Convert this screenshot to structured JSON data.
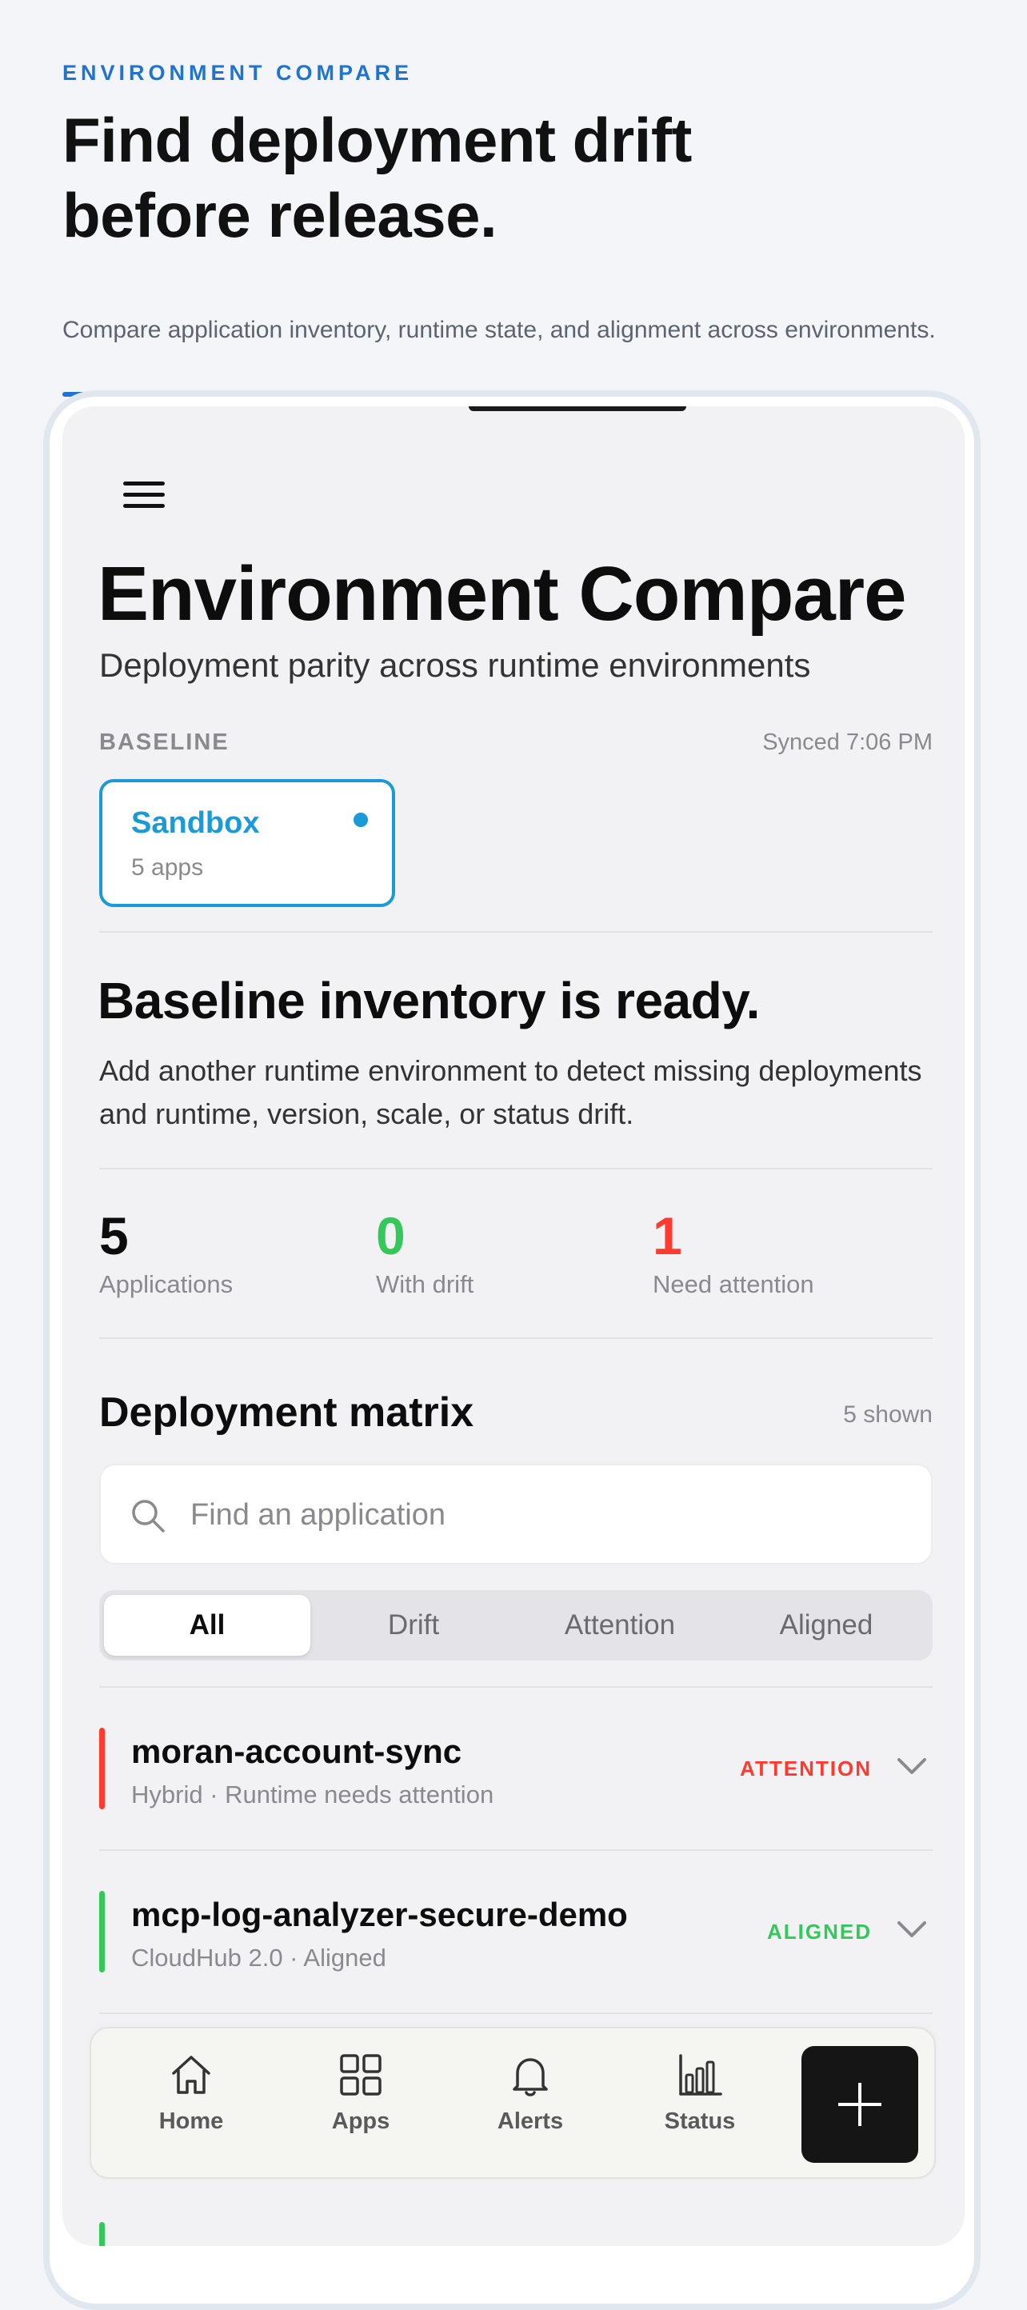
{
  "hero": {
    "eyebrow": "ENVIRONMENT COMPARE",
    "title": "Find deployment drift before release.",
    "subtitle": "Compare application inventory, runtime state, and alignment across environments."
  },
  "header": {
    "title": "Environment Compare",
    "subtitle": "Deployment parity across runtime environments"
  },
  "baseline": {
    "label": "BASELINE",
    "synced": "Synced 7:06 PM",
    "env_name": "Sandbox",
    "env_count": "5 apps"
  },
  "ready": {
    "title": "Baseline inventory is ready.",
    "body": "Add another runtime environment to detect missing deployments and runtime, version, scale, or status drift."
  },
  "stats": [
    {
      "value": "5",
      "label": "Applications",
      "color": "#0d0d0d"
    },
    {
      "value": "0",
      "label": "With drift",
      "color": "#34c759"
    },
    {
      "value": "1",
      "label": "Need attention",
      "color": "#ff3b30"
    }
  ],
  "matrix": {
    "title": "Deployment matrix",
    "count": "5 shown",
    "search_placeholder": "Find an application",
    "filters": [
      "All",
      "Drift",
      "Attention",
      "Aligned"
    ],
    "active_filter": "All"
  },
  "apps": [
    {
      "name": "moran-account-sync",
      "meta": "Hybrid · Runtime needs attention",
      "status": "ATTENTION",
      "color": "#ff3b30"
    },
    {
      "name": "mcp-log-analyzer-secure-demo",
      "meta": "CloudHub 2.0 · Aligned",
      "status": "ALIGNED",
      "color": "#34c759"
    }
  ],
  "tabbar": {
    "items": [
      {
        "label": "Home",
        "icon": "home-icon"
      },
      {
        "label": "Apps",
        "icon": "grid-icon"
      },
      {
        "label": "Alerts",
        "icon": "bell-icon"
      },
      {
        "label": "Status",
        "icon": "bar-chart-icon"
      }
    ],
    "add_icon": "plus-icon"
  },
  "colors": {
    "accent": "#1f74cf",
    "sandbox": "#1a9ad6",
    "attention": "#ff3b30",
    "aligned": "#34c759"
  }
}
